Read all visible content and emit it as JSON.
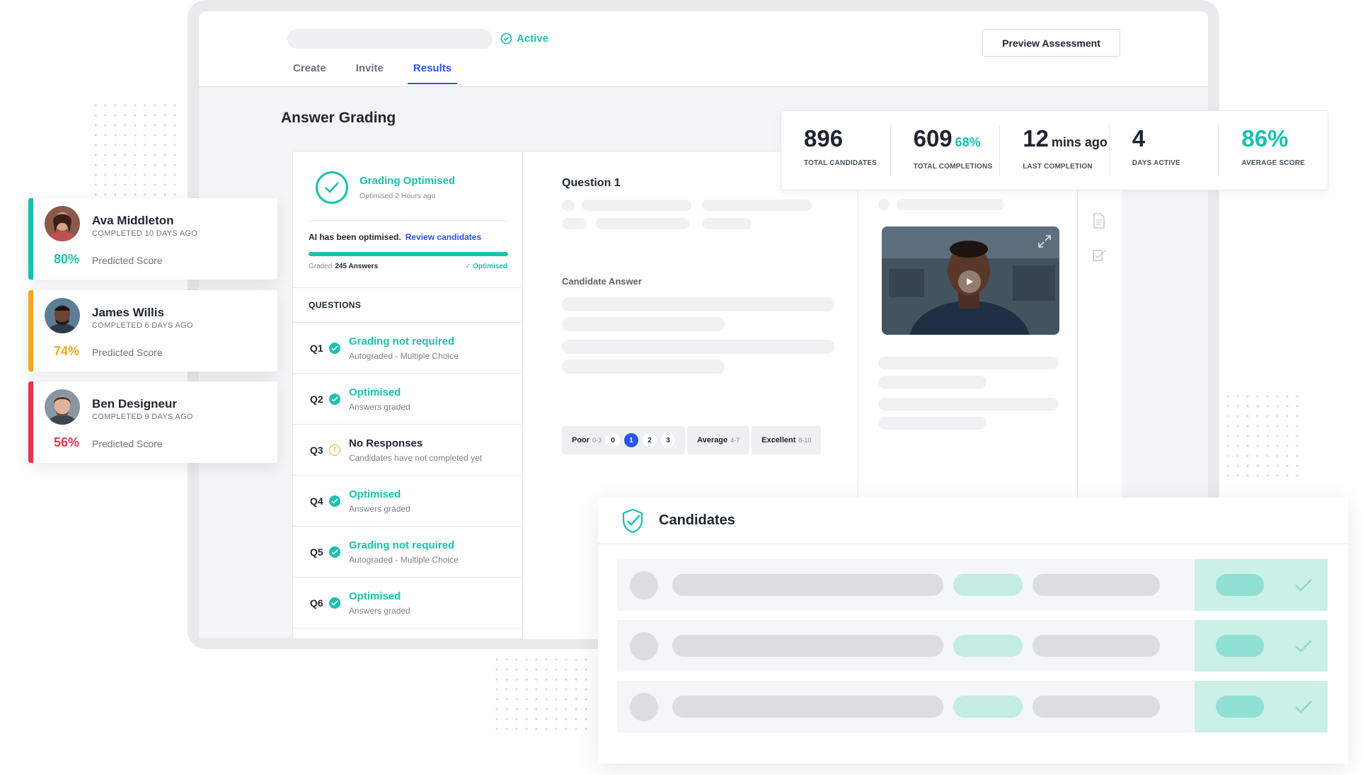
{
  "header": {
    "status": "Active",
    "preview_button": "Preview Assessment",
    "tabs": [
      "Create",
      "Invite",
      "Results"
    ]
  },
  "page_title": "Answer Grading",
  "grading": {
    "title": "Grading Optimised",
    "subtitle": "Optimised 2 Hours ago",
    "ai_text": "AI has been optimised.",
    "ai_link": "Review candidates",
    "graded_label": "Graded",
    "graded_count": "245 Answers",
    "graded_status": "✓ Optimised",
    "progress_fraction": 1.0,
    "questions_header": "QUESTIONS",
    "questions": [
      {
        "num": "Q1",
        "title": "Grading not required",
        "sub": "Autograded - Multiple Choice",
        "state": "ok"
      },
      {
        "num": "Q2",
        "title": "Optimised",
        "sub": "Answers graded",
        "state": "ok"
      },
      {
        "num": "Q3",
        "title": "No Responses",
        "sub": "Candidates have not completed yet",
        "state": "warn"
      },
      {
        "num": "Q4",
        "title": "Optimised",
        "sub": "Answers graded",
        "state": "ok"
      },
      {
        "num": "Q5",
        "title": "Grading not required",
        "sub": "Autograded - Multiple Choice",
        "state": "ok"
      },
      {
        "num": "Q6",
        "title": "Optimised",
        "sub": "Answers graded",
        "state": "ok"
      }
    ]
  },
  "question": {
    "title": "Question 1",
    "candidate_answer_label": "Candidate Answer",
    "scale": {
      "poor_label": "Poor",
      "poor_range": "0-3",
      "numbers": [
        "0",
        "1",
        "2",
        "3"
      ],
      "selected": "1",
      "average_label": "Average",
      "average_range": "4-7",
      "excellent_label": "Excellent",
      "excellent_range": "8-10"
    }
  },
  "stats": [
    {
      "value": "896",
      "extra": "",
      "label": "TOTAL CANDIDATES"
    },
    {
      "value": "609",
      "extra": "68%",
      "label": "TOTAL COMPLETIONS"
    },
    {
      "value": "12",
      "extra": "mins ago",
      "label": "LAST COMPLETION"
    },
    {
      "value": "4",
      "extra": "",
      "label": "DAYS ACTIVE"
    },
    {
      "value": "86%",
      "extra": "",
      "label": "AVERAGE SCORE"
    }
  ],
  "candidate_cards": [
    {
      "name": "Ava Middleton",
      "completed": "COMPLETED 10 DAYS AGO",
      "score": "80%",
      "score_label": "Predicted Score",
      "color": "#19c2ad"
    },
    {
      "name": "James Willis",
      "completed": "COMPLETED 6 DAYS AGO",
      "score": "74%",
      "score_label": "Predicted Score",
      "color": "#f5a623"
    },
    {
      "name": "Ben Designeur",
      "completed": "COMPLETED 9 DAYS AGO",
      "score": "56%",
      "score_label": "Predicted Score",
      "color": "#e8344e"
    }
  ],
  "candidates_panel": {
    "title": "Candidates"
  },
  "colors": {
    "accent": "#19c2ad",
    "link": "#2b55e8",
    "warn": "#f5a623",
    "danger": "#e8344e"
  }
}
